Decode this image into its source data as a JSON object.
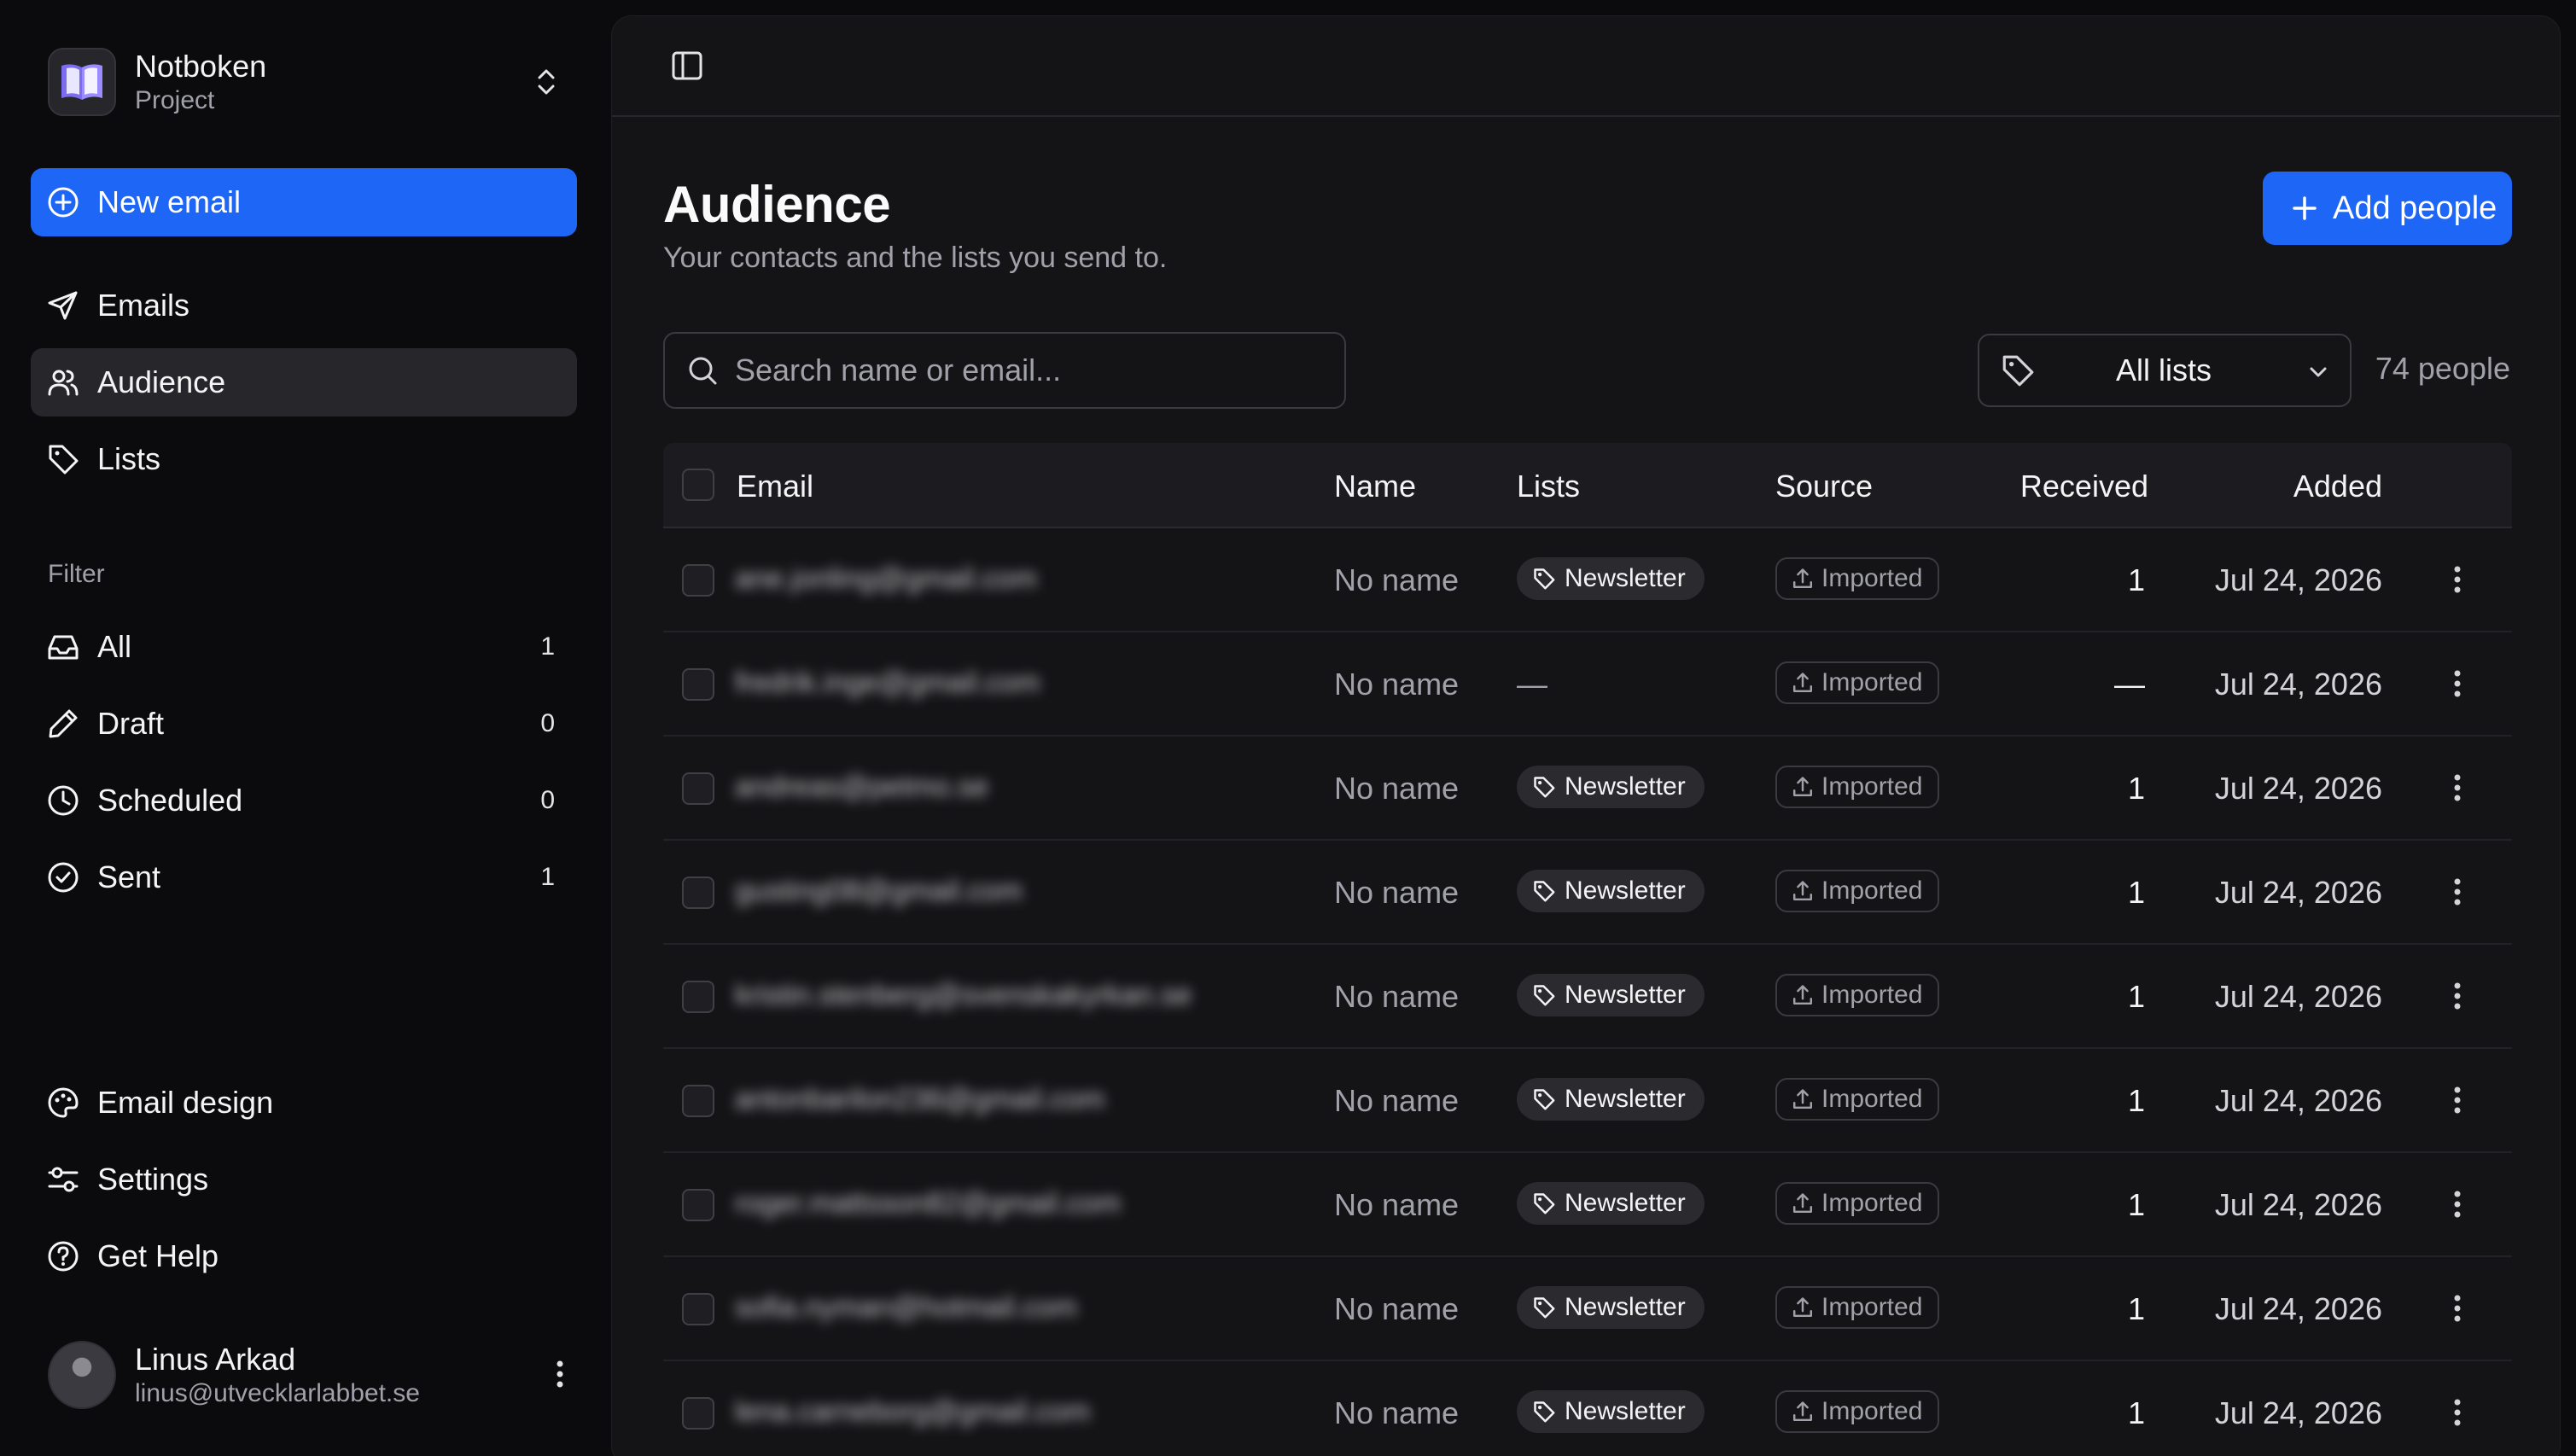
{
  "workspace": {
    "name": "Notboken",
    "subtitle": "Project"
  },
  "sidebar": {
    "new_email_label": "New email",
    "nav": [
      {
        "label": "Emails",
        "icon": "send-icon"
      },
      {
        "label": "Audience",
        "icon": "users-icon",
        "active": true
      },
      {
        "label": "Lists",
        "icon": "tag-icon"
      }
    ],
    "filter_label": "Filter",
    "filters": [
      {
        "label": "All",
        "count": "1",
        "icon": "inbox-icon"
      },
      {
        "label": "Draft",
        "count": "0",
        "icon": "pencil-icon"
      },
      {
        "label": "Scheduled",
        "count": "0",
        "icon": "clock-icon"
      },
      {
        "label": "Sent",
        "count": "1",
        "icon": "check-circle-icon"
      }
    ],
    "bottom": [
      {
        "label": "Email design",
        "icon": "palette-icon"
      },
      {
        "label": "Settings",
        "icon": "sliders-icon"
      },
      {
        "label": "Get Help",
        "icon": "help-circle-icon"
      }
    ],
    "user": {
      "name": "Linus Arkad",
      "email": "linus@utvecklarlabbet.se"
    }
  },
  "page": {
    "title": "Audience",
    "subtitle": "Your contacts and the lists you send to.",
    "add_button_label": "Add people",
    "search_placeholder": "Search name or email...",
    "list_filter": "All lists",
    "people_count": "74 people"
  },
  "table": {
    "columns": {
      "email": "Email",
      "name": "Name",
      "lists": "Lists",
      "source": "Source",
      "received": "Received",
      "added": "Added"
    },
    "rows": [
      {
        "email": "ane.jonling@gmail.com",
        "name": "No name",
        "list": "Newsletter",
        "source": "Imported",
        "received": "1",
        "added": "Jul 24, 2026"
      },
      {
        "email": "fredrik.inge@gmail.com",
        "name": "No name",
        "list": "—",
        "source": "Imported",
        "received": "—",
        "added": "Jul 24, 2026"
      },
      {
        "email": "andreas@petmo.se",
        "name": "No name",
        "list": "Newsletter",
        "source": "Imported",
        "received": "1",
        "added": "Jul 24, 2026"
      },
      {
        "email": "gusting08@gmail.com",
        "name": "No name",
        "list": "Newsletter",
        "source": "Imported",
        "received": "1",
        "added": "Jul 24, 2026"
      },
      {
        "email": "kristin.stenberg@svenskakyrkan.se",
        "name": "No name",
        "list": "Newsletter",
        "source": "Imported",
        "received": "1",
        "added": "Jul 24, 2026"
      },
      {
        "email": "antonbarilon236@gmail.com",
        "name": "No name",
        "list": "Newsletter",
        "source": "Imported",
        "received": "1",
        "added": "Jul 24, 2026"
      },
      {
        "email": "roger.mattsson82@gmail.com",
        "name": "No name",
        "list": "Newsletter",
        "source": "Imported",
        "received": "1",
        "added": "Jul 24, 2026"
      },
      {
        "email": "sofia.nyman@hotmail.com",
        "name": "No name",
        "list": "Newsletter",
        "source": "Imported",
        "received": "1",
        "added": "Jul 24, 2026"
      },
      {
        "email": "lena.carneborg@gmail.com",
        "name": "No name",
        "list": "Newsletter",
        "source": "Imported",
        "received": "1",
        "added": "Jul 24, 2026"
      }
    ]
  },
  "colors": {
    "accent": "#1e66f5",
    "background": "#0b0b0d",
    "panel": "#141417"
  }
}
